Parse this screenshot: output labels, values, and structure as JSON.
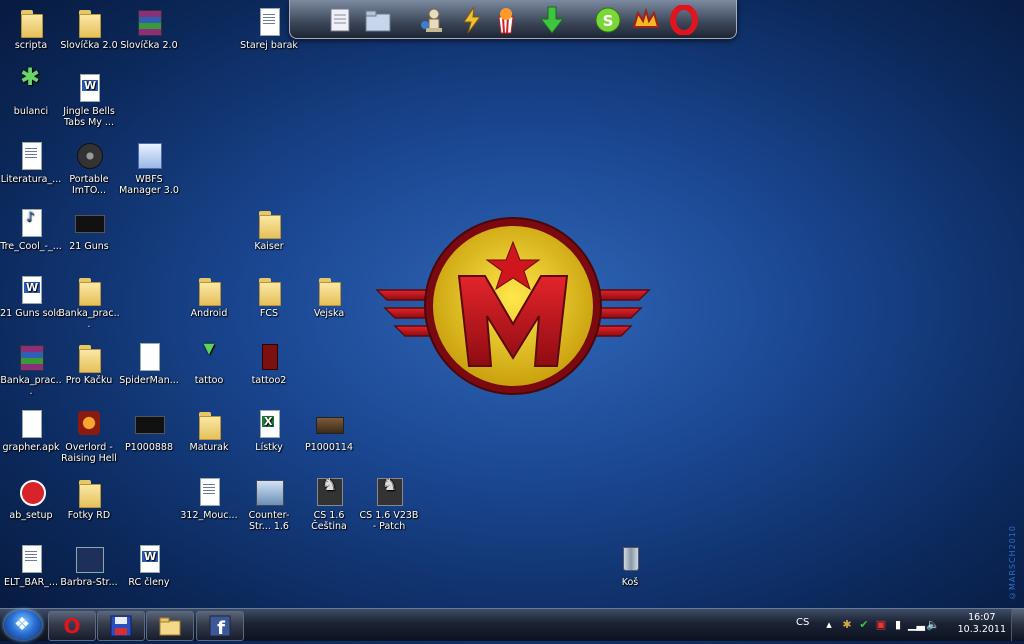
{
  "desktop": {
    "icons": [
      {
        "label": "scripta",
        "icon": "folder-icon"
      },
      {
        "label": "Slovíčka 2.0",
        "icon": "folder-icon"
      },
      {
        "label": "Slovíčka 2.0",
        "icon": "winrar-archive-icon"
      },
      {
        "label": "Starej barak",
        "icon": "text-document-icon"
      },
      {
        "label": "bulanci",
        "icon": "bulanci-game-icon"
      },
      {
        "label": "Jingle Bells Tabs My ...",
        "icon": "word-document-icon"
      },
      {
        "label": "Literatura_...",
        "icon": "text-document-icon"
      },
      {
        "label": "Portable ImTO...",
        "icon": "film-reel-icon"
      },
      {
        "label": "WBFS Manager 3.0",
        "icon": "wbfs-manager-icon"
      },
      {
        "label": "Tre_Cool_-_...",
        "icon": "mp3-file-icon"
      },
      {
        "label": "21 Guns",
        "icon": "video-thumbnail-icon"
      },
      {
        "label": "Kaiser",
        "icon": "folder-icon"
      },
      {
        "label": "21 Guns solo",
        "icon": "word-document-icon"
      },
      {
        "label": "Banka_prac...",
        "icon": "folder-icon"
      },
      {
        "label": "Android",
        "icon": "folder-icon"
      },
      {
        "label": "FCS",
        "icon": "folder-icon"
      },
      {
        "label": "Vejska",
        "icon": "folder-icon"
      },
      {
        "label": "Banka_prac...",
        "icon": "winrar-archive-icon"
      },
      {
        "label": "Pro Kačku",
        "icon": "folder-icon"
      },
      {
        "label": "SpiderMan...",
        "icon": "blank-file-icon"
      },
      {
        "label": "tattoo",
        "icon": "tattoo-image-icon"
      },
      {
        "label": "tattoo2",
        "icon": "tattoo2-image-icon"
      },
      {
        "label": "grapher.apk",
        "icon": "blank-file-icon"
      },
      {
        "label": "Overlord - Raising Hell",
        "icon": "overlord-game-icon"
      },
      {
        "label": "P1000888",
        "icon": "photo-thumbnail-icon"
      },
      {
        "label": "Maturak",
        "icon": "folder-icon"
      },
      {
        "label": "Lístky",
        "icon": "excel-document-icon"
      },
      {
        "label": "P1000114",
        "icon": "photo-thumbnail-icon"
      },
      {
        "label": "ab_setup",
        "icon": "angry-birds-icon"
      },
      {
        "label": "Fotky RD",
        "icon": "folder-icon"
      },
      {
        "label": "312_Mouc...",
        "icon": "text-document-icon"
      },
      {
        "label": "Counter-Str... 1.6",
        "icon": "counter-strike-icon"
      },
      {
        "label": "CS 1.6 Čeština",
        "icon": "counter-strike-icon"
      },
      {
        "label": "CS 1.6 V23B - Patch",
        "icon": "counter-strike-icon"
      },
      {
        "label": "ELT_BAR_...",
        "icon": "text-document-icon"
      },
      {
        "label": "Barbra-Str...",
        "icon": "video-thumbnail-icon"
      },
      {
        "label": "RC členy",
        "icon": "word-document-icon"
      },
      {
        "label": "Koš",
        "icon": "recycle-bin-icon"
      }
    ]
  },
  "dock": {
    "items": [
      "documents-icon",
      "folder-icon",
      "chess-icon",
      "lightning-icon",
      "popcorn-icon",
      "download-arrow-icon",
      "skype-icon",
      "winamp-icon",
      "opera-icon"
    ]
  },
  "watermark": "©MARSCH2010",
  "taskbar": {
    "pinned": [
      "opera-icon",
      "save-icon",
      "explorer-icon",
      "facebook-icon"
    ],
    "tray": {
      "language": "CS",
      "time": "16:07",
      "date": "10.3.2011"
    }
  },
  "colors": {
    "accent": "#1a4690",
    "emblem_red": "#c8141b",
    "emblem_yellow": "#f2c817"
  }
}
